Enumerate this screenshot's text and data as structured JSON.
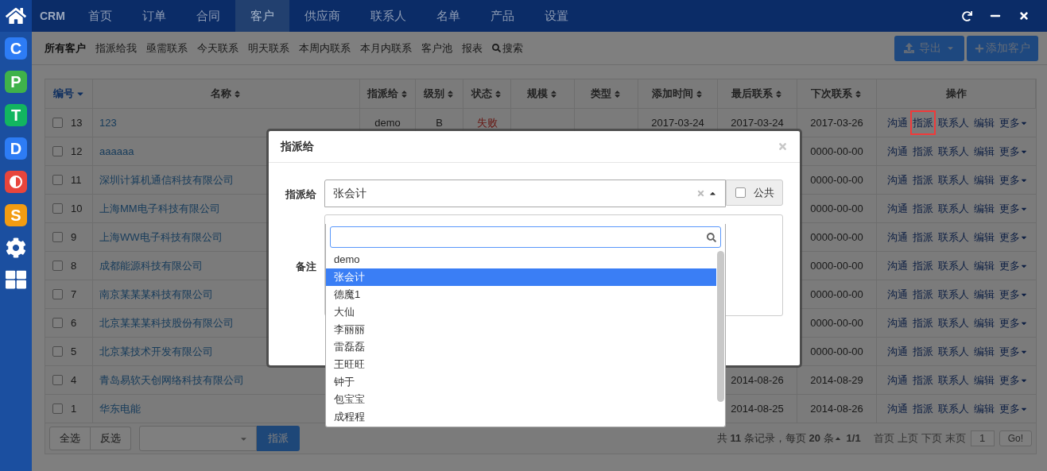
{
  "sidebar": {
    "apps": [
      {
        "kind": "letter",
        "letter": "C",
        "color": "#2d7cf5"
      },
      {
        "kind": "letter",
        "letter": "P",
        "color": "#3fb24a"
      },
      {
        "kind": "letter",
        "letter": "T",
        "color": "#12b560"
      },
      {
        "kind": "letter",
        "letter": "D",
        "color": "#2d7cf5"
      },
      {
        "kind": "half",
        "color": "#e8453c"
      },
      {
        "kind": "letter",
        "letter": "S",
        "color": "#f39c12"
      },
      {
        "kind": "gear"
      },
      {
        "kind": "grid"
      }
    ]
  },
  "topbar": {
    "brand": "CRM",
    "nav": [
      {
        "label": "首页",
        "selected": false
      },
      {
        "label": "订单",
        "selected": false
      },
      {
        "label": "合同",
        "selected": false
      },
      {
        "label": "客户",
        "selected": true
      },
      {
        "label": "供应商",
        "selected": false
      },
      {
        "label": "联系人",
        "selected": false
      },
      {
        "label": "名单",
        "selected": false
      },
      {
        "label": "产品",
        "selected": false
      },
      {
        "label": "设置",
        "selected": false
      }
    ]
  },
  "subnav": {
    "items": [
      {
        "kind": "link",
        "label": "所有客户",
        "selected": true
      },
      {
        "kind": "link",
        "label": "指派给我",
        "selected": false
      },
      {
        "kind": "link",
        "label": "亟需联系",
        "selected": false
      },
      {
        "kind": "link",
        "label": "今天联系",
        "selected": false
      },
      {
        "kind": "link",
        "label": "明天联系",
        "selected": false
      },
      {
        "kind": "link",
        "label": "本周内联系",
        "selected": false
      },
      {
        "kind": "link",
        "label": "本月内联系",
        "selected": false
      },
      {
        "kind": "link",
        "label": "客户池",
        "selected": false
      },
      {
        "kind": "link",
        "label": "报表",
        "selected": false
      },
      {
        "kind": "search",
        "label": "搜索",
        "selected": false
      }
    ],
    "export_button": "导出",
    "add_button": "添加客户"
  },
  "table": {
    "columns": [
      {
        "label": "编号",
        "sortable": true,
        "sorted": true
      },
      {
        "label": "名称",
        "sortable": true,
        "sorted": false
      },
      {
        "label": "指派给",
        "sortable": true,
        "sorted": false
      },
      {
        "label": "级别",
        "sortable": true,
        "sorted": false
      },
      {
        "label": "状态",
        "sortable": true,
        "sorted": false
      },
      {
        "label": "规模",
        "sortable": true,
        "sorted": false
      },
      {
        "label": "类型",
        "sortable": true,
        "sorted": false
      },
      {
        "label": "添加时间",
        "sortable": true,
        "sorted": false
      },
      {
        "label": "最后联系",
        "sortable": true,
        "sorted": false
      },
      {
        "label": "下次联系",
        "sortable": true,
        "sorted": false
      },
      {
        "label": "操作",
        "sortable": false,
        "sorted": false
      }
    ],
    "rows": [
      {
        "id": "13",
        "checked": false,
        "name": "123",
        "assignee": "demo",
        "level": "B",
        "status": "失败",
        "added": "2017-03-24",
        "last": "2017-03-24",
        "next": "2017-03-26",
        "actions": [
          {
            "label": "沟通",
            "highlighted": false
          },
          {
            "label": "指派",
            "highlighted": true
          },
          {
            "label": "联系人",
            "highlighted": false
          },
          {
            "label": "编辑",
            "highlighted": false
          },
          {
            "label": "更多",
            "highlighted": false
          }
        ]
      },
      {
        "id": "12",
        "checked": false,
        "name": "aaaaaa",
        "next": "0000-00-00",
        "actions": [
          {
            "label": "沟通",
            "highlighted": false
          },
          {
            "label": "指派",
            "highlighted": false
          },
          {
            "label": "联系人",
            "highlighted": false
          },
          {
            "label": "编辑",
            "highlighted": false
          },
          {
            "label": "更多",
            "highlighted": false
          }
        ]
      },
      {
        "id": "11",
        "checked": false,
        "name": "深圳计算机通信科技有限公司",
        "next": "0000-00-00",
        "actions": [
          {
            "label": "沟通",
            "highlighted": false
          },
          {
            "label": "指派",
            "highlighted": false
          },
          {
            "label": "联系人",
            "highlighted": false
          },
          {
            "label": "编辑",
            "highlighted": false
          },
          {
            "label": "更多",
            "highlighted": false
          }
        ]
      },
      {
        "id": "10",
        "checked": false,
        "name": "上海MM电子科技有限公司",
        "next": "0000-00-00",
        "actions": [
          {
            "label": "沟通",
            "highlighted": false
          },
          {
            "label": "指派",
            "highlighted": false
          },
          {
            "label": "联系人",
            "highlighted": false
          },
          {
            "label": "编辑",
            "highlighted": false
          },
          {
            "label": "更多",
            "highlighted": false
          }
        ]
      },
      {
        "id": "9",
        "checked": false,
        "name": "上海WW电子科技有限公司",
        "next": "0000-00-00",
        "actions": [
          {
            "label": "沟通",
            "highlighted": false
          },
          {
            "label": "指派",
            "highlighted": false
          },
          {
            "label": "联系人",
            "highlighted": false
          },
          {
            "label": "编辑",
            "highlighted": false
          },
          {
            "label": "更多",
            "highlighted": false
          }
        ]
      },
      {
        "id": "8",
        "checked": false,
        "name": "成都能源科技有限公司",
        "next": "0000-00-00",
        "actions": [
          {
            "label": "沟通",
            "highlighted": false
          },
          {
            "label": "指派",
            "highlighted": false
          },
          {
            "label": "联系人",
            "highlighted": false
          },
          {
            "label": "编辑",
            "highlighted": false
          },
          {
            "label": "更多",
            "highlighted": false
          }
        ]
      },
      {
        "id": "7",
        "checked": false,
        "name": "南京某某某科技有限公司",
        "next": "0000-00-00",
        "actions": [
          {
            "label": "沟通",
            "highlighted": false
          },
          {
            "label": "指派",
            "highlighted": false
          },
          {
            "label": "联系人",
            "highlighted": false
          },
          {
            "label": "编辑",
            "highlighted": false
          },
          {
            "label": "更多",
            "highlighted": false
          }
        ]
      },
      {
        "id": "6",
        "checked": false,
        "name": "北京某某某科技股份有限公司",
        "next": "0000-00-00",
        "actions": [
          {
            "label": "沟通",
            "highlighted": false
          },
          {
            "label": "指派",
            "highlighted": false
          },
          {
            "label": "联系人",
            "highlighted": false
          },
          {
            "label": "编辑",
            "highlighted": false
          },
          {
            "label": "更多",
            "highlighted": false
          }
        ]
      },
      {
        "id": "5",
        "checked": false,
        "name": "北京某技术开发有限公司",
        "next": "0000-00-00",
        "actions": [
          {
            "label": "沟通",
            "highlighted": false
          },
          {
            "label": "指派",
            "highlighted": false
          },
          {
            "label": "联系人",
            "highlighted": false
          },
          {
            "label": "编辑",
            "highlighted": false
          },
          {
            "label": "更多",
            "highlighted": false
          }
        ]
      },
      {
        "id": "4",
        "checked": false,
        "name": "青岛易软天创网络科技有限公司",
        "last": "2014-08-26",
        "next": "2014-08-29",
        "actions": [
          {
            "label": "沟通",
            "highlighted": false
          },
          {
            "label": "指派",
            "highlighted": false
          },
          {
            "label": "联系人",
            "highlighted": false
          },
          {
            "label": "编辑",
            "highlighted": false
          },
          {
            "label": "更多",
            "highlighted": false
          }
        ]
      },
      {
        "id": "1",
        "checked": false,
        "name": "华东电能",
        "last": "2014-08-25",
        "next": "2014-08-26",
        "actions": [
          {
            "label": "沟通",
            "highlighted": false
          },
          {
            "label": "指派",
            "highlighted": false
          },
          {
            "label": "联系人",
            "highlighted": false
          },
          {
            "label": "编辑",
            "highlighted": false
          },
          {
            "label": "更多",
            "highlighted": false
          }
        ]
      }
    ]
  },
  "footer": {
    "select_all": "全选",
    "invert": "反选",
    "assign_button": "指派",
    "summary": "共 **11** 条记录，每页 **20** 条",
    "pages": "1/1",
    "pager": [
      "首页",
      "上页",
      "下页",
      "末页"
    ],
    "page_value": "1",
    "go": "Go!"
  },
  "modal": {
    "title": "指派给",
    "assign_label": "指派给",
    "assign_value": "张会计",
    "public": {
      "label": "公共",
      "checked": false
    },
    "note_label": "备注",
    "dropdown": {
      "options": [
        {
          "label": "demo",
          "selected": false
        },
        {
          "label": "张会计",
          "selected": true
        },
        {
          "label": "德魔1",
          "selected": false
        },
        {
          "label": "大仙",
          "selected": false
        },
        {
          "label": "李丽丽",
          "selected": false
        },
        {
          "label": "雷磊磊",
          "selected": false
        },
        {
          "label": "王旺旺",
          "selected": false
        },
        {
          "label": "钟于",
          "selected": false
        },
        {
          "label": "包宝宝",
          "selected": false
        },
        {
          "label": "成程程",
          "selected": false
        }
      ]
    }
  }
}
